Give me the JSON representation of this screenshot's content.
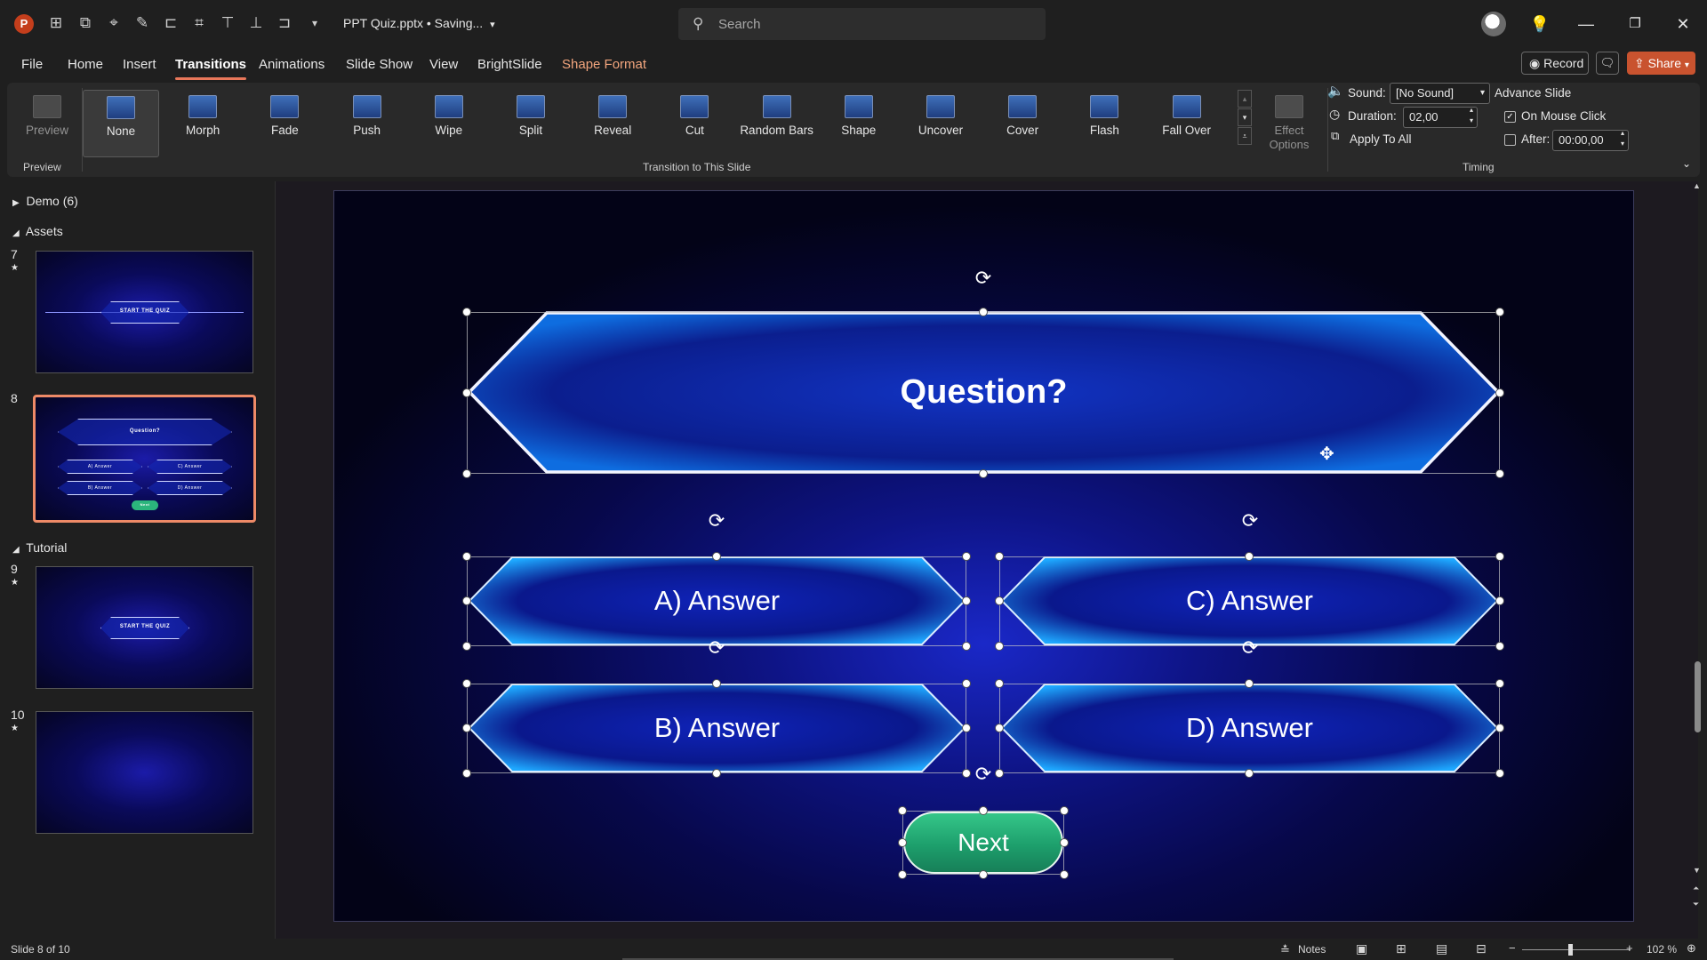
{
  "app": {
    "logo_letter": "P",
    "doc_title": "PPT Quiz.pptx • Saving...",
    "search_placeholder": "Search"
  },
  "menu": {
    "tabs": [
      "File",
      "Home",
      "Insert",
      "Transitions",
      "Animations",
      "Slide Show",
      "View",
      "BrightSlide",
      "Shape Format"
    ],
    "active": "Transitions",
    "record_label": "Record",
    "share_label": "Share"
  },
  "ribbon": {
    "preview_label": "Preview",
    "preview_group_label": "Preview",
    "transitions": [
      "None",
      "Morph",
      "Fade",
      "Push",
      "Wipe",
      "Split",
      "Reveal",
      "Cut",
      "Random Bars",
      "Shape",
      "Uncover",
      "Cover",
      "Flash",
      "Fall Over"
    ],
    "selected_transition": "None",
    "transition_group_label": "Transition to This Slide",
    "effect_options_label": "Effect Options",
    "timing": {
      "sound_label": "Sound:",
      "sound_value": "[No Sound]",
      "duration_label": "Duration:",
      "duration_value": "02,00",
      "apply_all_label": "Apply To All",
      "advance_label": "Advance Slide",
      "on_mouse_click_label": "On Mouse Click",
      "on_mouse_click_checked": true,
      "after_label": "After:",
      "after_value": "00:00,00",
      "after_checked": false,
      "group_label": "Timing"
    }
  },
  "slides_panel": {
    "sections": [
      {
        "name": "Demo (6)",
        "collapsed": true
      },
      {
        "name": "Assets",
        "collapsed": false
      },
      {
        "name": "Tutorial",
        "collapsed": false
      }
    ],
    "thumbnails": [
      {
        "number": "7",
        "star": "★",
        "text": "START THE QUIZ"
      },
      {
        "number": "8",
        "star": "",
        "text": "Question?",
        "answers": [
          "A) Answer",
          "C) Answer",
          "B) Answer",
          "D) Answer"
        ],
        "next": "Next"
      },
      {
        "number": "9",
        "star": "★",
        "text": "START THE QUIZ"
      },
      {
        "number": "10",
        "star": "★",
        "text": ""
      }
    ],
    "selected": "8"
  },
  "slide": {
    "question": "Question?",
    "answers": {
      "a": "A) Answer",
      "b": "B) Answer",
      "c": "C) Answer",
      "d": "D) Answer"
    },
    "next_label": "Next"
  },
  "status": {
    "slide_info": "Slide 8 of 10",
    "notes_label": "Notes",
    "zoom": "102 %"
  }
}
